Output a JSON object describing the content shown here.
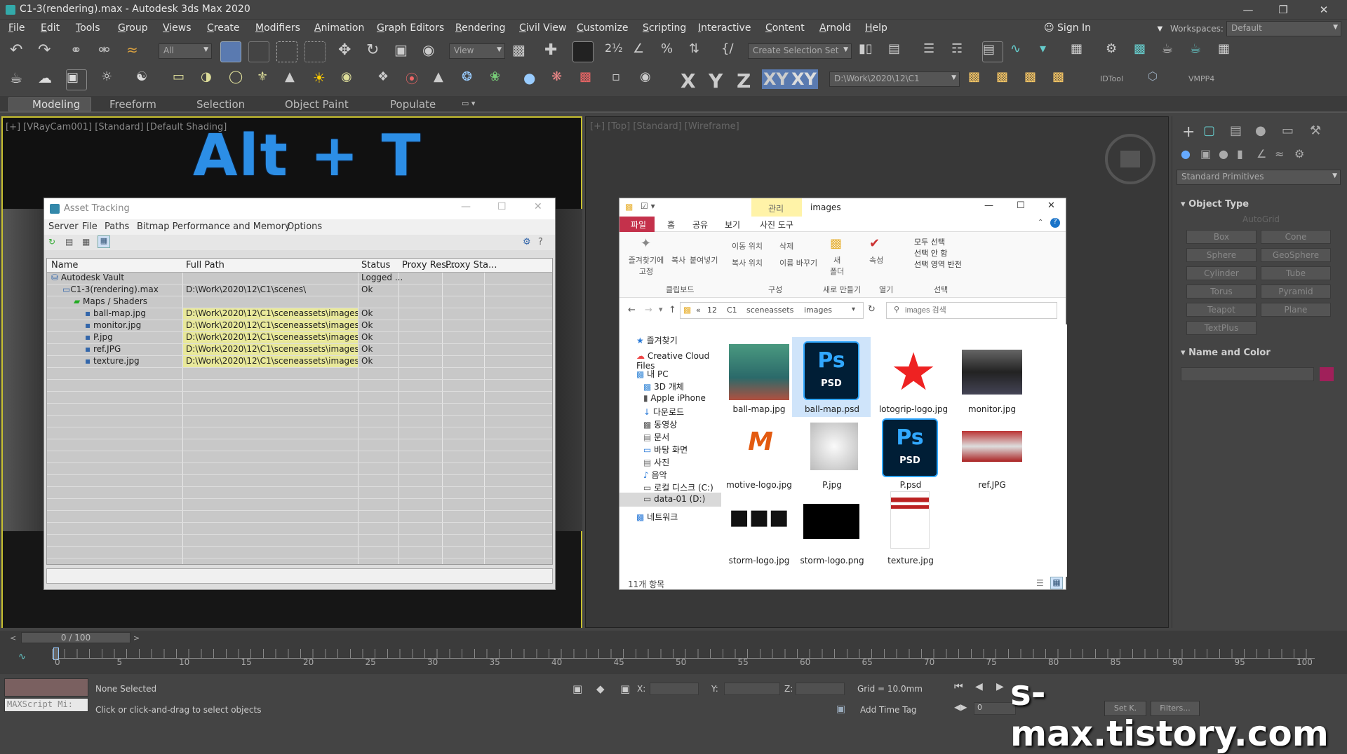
{
  "window": {
    "title": "C1-3(rendering).max - Autodesk 3ds Max 2020"
  },
  "menu": [
    "File",
    "Edit",
    "Tools",
    "Group",
    "Views",
    "Create",
    "Modifiers",
    "Animation",
    "Graph Editors",
    "Rendering",
    "Civil View",
    "Customize",
    "Scripting",
    "Interactive",
    "Content",
    "Arnold",
    "Help"
  ],
  "sign_in": "Sign In",
  "workspaces_label": "Workspaces:",
  "workspaces_value": "Default",
  "toolbar": {
    "filter": "All",
    "view": "View",
    "selection_set": "Create Selection Set",
    "path": "D:\\Work\\2020\\12\\C1",
    "idtool": "IDTool",
    "vmpp4": "VMPP4",
    "axes": [
      "X",
      "Y",
      "Z",
      "XY",
      "XY"
    ]
  },
  "ribbon_tabs": [
    "Modeling",
    "Freeform",
    "Selection",
    "Object Paint",
    "Populate"
  ],
  "viewport_left": {
    "label": "[+] [VRayCam001] [Standard] [Default Shading]"
  },
  "viewport_right": {
    "label": "[+] [Top] [Standard] [Wireframe]"
  },
  "overlay_text": "Alt + T",
  "command_panel": {
    "dropdown": "Standard Primitives",
    "object_type": "Object Type",
    "autogrid": "AutoGrid",
    "buttons": [
      "Box",
      "Cone",
      "Sphere",
      "GeoSphere",
      "Cylinder",
      "Tube",
      "Torus",
      "Pyramid",
      "Teapot",
      "Plane",
      "TextPlus"
    ],
    "name_and_color": "Name and Color"
  },
  "asset_tracking": {
    "title": "Asset Tracking",
    "menu": [
      "Server",
      "File",
      "Paths",
      "Bitmap Performance and Memory",
      "Options"
    ],
    "columns": [
      "Name",
      "Full Path",
      "Status",
      "Proxy Res...",
      "Proxy Sta..."
    ],
    "rows": [
      {
        "name": "Autodesk Vault",
        "path": "",
        "status": "Logged ...",
        "indent": 0
      },
      {
        "name": "C1-3(rendering).max",
        "path": "D:\\Work\\2020\\12\\C1\\scenes\\",
        "status": "Ok",
        "indent": 1
      },
      {
        "name": "Maps / Shaders",
        "path": "",
        "status": "",
        "indent": 2
      },
      {
        "name": "ball-map.jpg",
        "path": "D:\\Work\\2020\\12\\C1\\sceneassets\\images\\",
        "status": "Ok",
        "indent": 3
      },
      {
        "name": "monitor.jpg",
        "path": "D:\\Work\\2020\\12\\C1\\sceneassets\\images\\",
        "status": "Ok",
        "indent": 3
      },
      {
        "name": "P.jpg",
        "path": "D:\\Work\\2020\\12\\C1\\sceneassets\\images\\",
        "status": "Ok",
        "indent": 3
      },
      {
        "name": "ref.JPG",
        "path": "D:\\Work\\2020\\12\\C1\\sceneassets\\images\\",
        "status": "Ok",
        "indent": 3
      },
      {
        "name": "texture.jpg",
        "path": "D:\\Work\\2020\\12\\C1\\sceneassets\\images\\",
        "status": "Ok",
        "indent": 3
      }
    ]
  },
  "explorer": {
    "title": "images",
    "manage": "관리",
    "photo_tools": "사진 도구",
    "tabs": [
      "파일",
      "홈",
      "공유",
      "보기"
    ],
    "ribbon": {
      "pin": "즐겨찾기에\n고정",
      "copy": "복사",
      "paste": "붙여넣기",
      "clipboard": "클립보드",
      "move_to": "이동 위치",
      "copy_to": "복사 위치",
      "delete": "삭제",
      "rename": "이름 바꾸기",
      "organize": "구성",
      "new_folder": "새\n폴더",
      "new": "새로 만들기",
      "properties": "속성",
      "open": "열기",
      "select_all": "모두 선택",
      "select_none": "선택 안 함",
      "invert": "선택 영역 반전",
      "select": "선택"
    },
    "breadcrumb": [
      "«",
      "12",
      "C1",
      "sceneassets",
      "images"
    ],
    "search_placeholder": "images 검색",
    "nav": [
      "즐겨찾기",
      "Creative Cloud Files",
      "내 PC",
      "3D 개체",
      "Apple iPhone",
      "다운로드",
      "동영상",
      "문서",
      "바탕 화면",
      "사진",
      "음악",
      "로컬 디스크 (C:)",
      "data-01 (D:)",
      "네트워크"
    ],
    "files": [
      "ball-map.jpg",
      "ball-map.psd",
      "lotogrip-logo.jpg",
      "monitor.jpg",
      "motive-logo.jpg",
      "P.jpg",
      "P.psd",
      "ref.JPG",
      "storm-logo.jpg",
      "storm-logo.png",
      "texture.jpg"
    ],
    "status": "11개 항목"
  },
  "timeline": {
    "frame": "0 / 100",
    "ticks": [
      "0",
      "5",
      "10",
      "15",
      "20",
      "25",
      "30",
      "35",
      "40",
      "45",
      "50",
      "55",
      "60",
      "65",
      "70",
      "75",
      "80",
      "85",
      "90",
      "95",
      "100"
    ]
  },
  "status": {
    "none_selected": "None Selected",
    "hint": "Click or click-and-drag to select objects",
    "maxscript": "MAXScript Mi:",
    "x": "X:",
    "y": "Y:",
    "z": "Z:",
    "grid": "Grid = 10.0mm",
    "add_time_tag": "Add Time Tag",
    "frame_field": "0",
    "set_k": "Set K.",
    "filters": "Filters..."
  },
  "watermark": "s-max.tistory.com"
}
